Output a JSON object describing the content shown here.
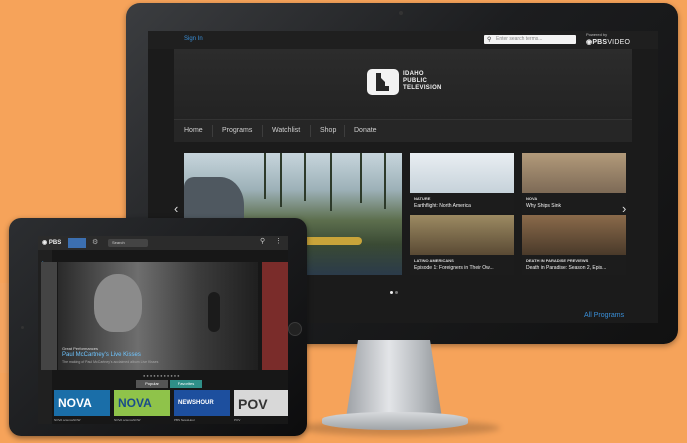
{
  "monitor": {
    "topbar": {
      "sign_in": "Sign In",
      "search_placeholder": "Enter search terms...",
      "powered_by": "Powered by",
      "pbs": "PBS",
      "video": "VIDEO"
    },
    "logo": {
      "line1": "IDAHO",
      "line2": "PUBLIC",
      "line3": "TELEVISION"
    },
    "nav": [
      "Home",
      "Programs",
      "Watchlist",
      "Shop",
      "Donate"
    ],
    "tiles": [
      {
        "category": "NATURE",
        "title": "Earthflight: North America",
        "colors": [
          "#e9eef2",
          "#c6d2da"
        ]
      },
      {
        "category": "NOVA",
        "title": "Why Ships Sink",
        "colors": [
          "#b29a7a",
          "#7d6a56"
        ]
      },
      {
        "category": "LATINO AMERICANS",
        "title": "Episode 1: Foreigners in Their Ow...",
        "colors": [
          "#9c8a62",
          "#5a4a34"
        ]
      },
      {
        "category": "DEATH IN PARADISE PREVIEWS",
        "title": "Death in Paradise: Season 2, Epis...",
        "colors": [
          "#8a6a4a",
          "#4a3a2a"
        ]
      }
    ],
    "all_programs": "All Programs",
    "colors": {
      "link": "#3a8fd8",
      "background": "#1b1b1b"
    }
  },
  "tablet": {
    "topbar": {
      "pbs": "PBS",
      "search_field": "Search"
    },
    "hero": {
      "label": "Great Performances",
      "title": "Paul McCartney's Live Kisses",
      "subtitle": "The making of Paul McCartney's acclaimed album Live Kisses"
    },
    "tabs": [
      "Popular",
      "Favorites"
    ],
    "cards": [
      {
        "logo": "NOVA",
        "caption": "NOVA scienceNOW",
        "color": "#1a6ea8"
      },
      {
        "logo": "NOVA",
        "caption": "NOVA scienceNOW",
        "color": "#8fc34a"
      },
      {
        "logo": "NEWSHOUR",
        "caption": "PBS NewsHour",
        "color": "#1d4f9e"
      },
      {
        "logo": "POV",
        "caption": "POV",
        "color": "#d8d8d8"
      }
    ]
  }
}
